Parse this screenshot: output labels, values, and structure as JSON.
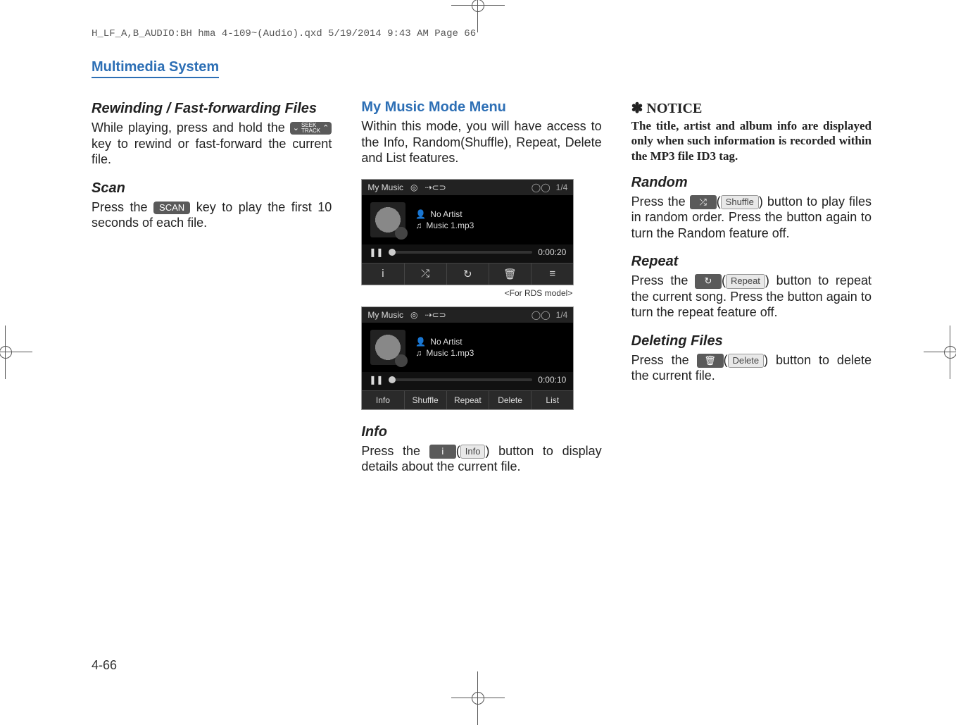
{
  "header_line": "H_LF_A,B_AUDIO:BH hma 4-109~(Audio).qxd  5/19/2014  9:43 AM  Page 66",
  "section_header": "Multimedia System",
  "col1": {
    "h1": "Rewinding / Fast-forwarding Files",
    "p1a": "While playing, press and hold the ",
    "p1b": " key to rewind or fast-forward the current file.",
    "seek_top": "SEEK",
    "seek_bot": "TRACK",
    "h2": "Scan",
    "p2a": "Press the ",
    "scan_key": "SCAN",
    "p2b": " key to play the first 10 seconds of each file."
  },
  "col2": {
    "h1": "My Music Mode Menu",
    "p1": "Within this mode, you will have access to the Info, Random(Shuffle), Repeat, Delete and List features.",
    "shot": {
      "title": "My Music",
      "counter": "1/4",
      "artist": "No Artist",
      "track": "Music 1.mp3",
      "time_rds": "0:00:20",
      "time_alt": "0:00:10",
      "icons": [
        "i",
        "⤮",
        "↻",
        "🗑",
        "≡"
      ],
      "labels": [
        "Info",
        "Shuffle",
        "Repeat",
        "Delete",
        "List"
      ]
    },
    "caption_rds": "<For RDS model>",
    "h_info": "Info",
    "p_info_a": "Press the ",
    "p_info_b": " button to display details about the current file.",
    "info_icon": "i",
    "info_label": "Info"
  },
  "col3": {
    "notice_head": "NOTICE",
    "notice_body": "The title, artist and album info are displayed only when such information is recorded within the MP3 file ID3 tag.",
    "h_random": "Random",
    "random_a": "Press the ",
    "random_icon": "⤮",
    "random_label": "Shuffle",
    "random_b": " button to play files in random order. Press the button again to turn the Random feature off.",
    "h_repeat": "Repeat",
    "repeat_a": "Press the ",
    "repeat_icon": "↻",
    "repeat_label": "Repeat",
    "repeat_b": " button to repeat the current song. Press the button again to turn the repeat feature off.",
    "h_delete": "Deleting Files",
    "delete_a": "Press the ",
    "delete_icon": "🗑",
    "delete_label": "Delete",
    "delete_b": " button to delete the current file."
  },
  "page_num": "4-66"
}
